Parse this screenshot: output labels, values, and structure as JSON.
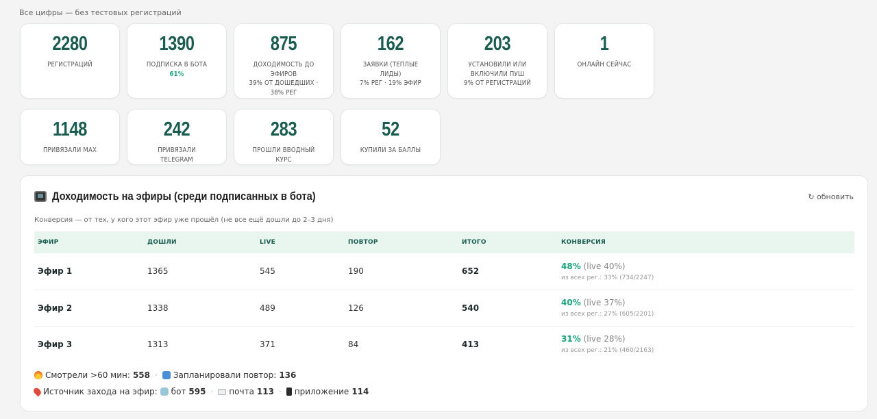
{
  "top_note": "Все цифры — без тестовых регистраций",
  "cards_row1": [
    {
      "value": "2280",
      "label": "Регистраций",
      "label2": "",
      "accent": ""
    },
    {
      "value": "1390",
      "label": "Подписка в бота ",
      "label2": "",
      "accent": "61%"
    },
    {
      "value": "875",
      "label": "Доходимость до эфиров",
      "label2": "39% от дошедших · 38% рег",
      "accent": ""
    },
    {
      "value": "162",
      "label": "Заявки (тёплые лиды)",
      "label2": "7% рег · 19% эфир",
      "accent": ""
    },
    {
      "value": "203",
      "label": "Установили или включили пуш",
      "label2": "9% от регистраций",
      "accent": ""
    },
    {
      "value": "1",
      "label": "Онлайн сейчас",
      "label2": "",
      "accent": ""
    }
  ],
  "cards_row2": [
    {
      "value": "1148",
      "label": "Привязали MAX"
    },
    {
      "value": "242",
      "label": "Привязали Telegram"
    },
    {
      "value": "283",
      "label": "Прошли вводный курс"
    },
    {
      "value": "52",
      "label": "Купили за баллы"
    }
  ],
  "panel": {
    "title": "Доходимость на эфиры (среди подписанных в бота)",
    "refresh_label": "↻ обновить",
    "subnote": "Конверсия — от тех, у кого этот эфир уже прошёл (не все ещё дошли до 2–3 дня)",
    "columns": [
      "Эфир",
      "Дошли",
      "Live",
      "Повтор",
      "Итого",
      "Конверсия"
    ],
    "rows": [
      {
        "name": "Эфир 1",
        "arrived": "1365",
        "live": "545",
        "repeat": "190",
        "total": "652",
        "conv": "48%",
        "conv_live": " (live 40%)",
        "conv_sub": "из всех рег.: 33% (734/2247)"
      },
      {
        "name": "Эфир 2",
        "arrived": "1338",
        "live": "489",
        "repeat": "126",
        "total": "540",
        "conv": "40%",
        "conv_live": " (live 37%)",
        "conv_sub": "из всех рег.: 27% (605/2201)"
      },
      {
        "name": "Эфир 3",
        "arrived": "1313",
        "live": "371",
        "repeat": "84",
        "total": "413",
        "conv": "31%",
        "conv_live": " (live 28%)",
        "conv_sub": "из всех рег.: 21% (460/2163)"
      }
    ],
    "footer1": {
      "watched_label": "Смотрели >60 мин:",
      "watched_value": "558",
      "planned_label": "Запланировали повтор:",
      "planned_value": "136"
    },
    "footer2": {
      "source_label": "Источник захода на эфир:",
      "bot_label": "бот",
      "bot_value": "595",
      "mail_label": "почта",
      "mail_value": "113",
      "app_label": "приложение",
      "app_value": "114"
    }
  }
}
